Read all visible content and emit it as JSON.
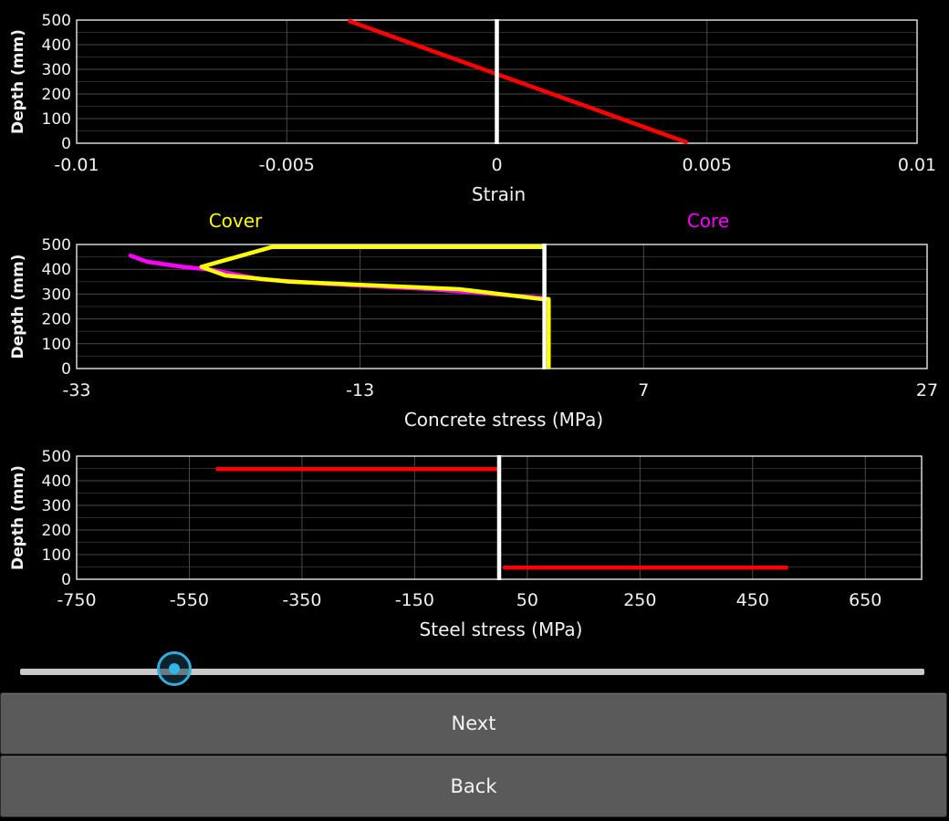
{
  "chart_data": [
    {
      "type": "line",
      "xlabel": "Strain",
      "ylabel": "Depth (mm)",
      "xlim": [
        -0.01,
        0.01
      ],
      "ylim": [
        0,
        500
      ],
      "x_ticks": [
        "-0.01",
        "-0.005",
        "0",
        "0.005",
        "0.01"
      ],
      "y_ticks": [
        "0",
        "100",
        "200",
        "300",
        "400",
        "500"
      ],
      "grid": true,
      "series": [
        {
          "color": "#ff0000",
          "points": [
            [
              -0.0035,
              495
            ],
            [
              0.0045,
              5
            ]
          ]
        }
      ],
      "reference_line": {
        "x": 0,
        "color": "#ffffff"
      }
    },
    {
      "type": "line",
      "xlabel": "Concrete stress (MPa)",
      "ylabel": "Depth (mm)",
      "xlim": [
        -33,
        27
      ],
      "ylim": [
        0,
        500
      ],
      "x_ticks": [
        "-33",
        "-13",
        "7",
        "27"
      ],
      "y_ticks": [
        "0",
        "100",
        "200",
        "300",
        "400",
        "500"
      ],
      "grid": true,
      "legend": [
        "Cover",
        "Core"
      ],
      "series": [
        {
          "name": "Core",
          "color": "#ff00ff",
          "points": [
            [
              -29.2,
              455
            ],
            [
              -28,
              430
            ],
            [
              -25.5,
              410
            ],
            [
              -23.5,
              398
            ],
            [
              -20,
              360
            ],
            [
              -15,
              340
            ],
            [
              -8,
              320
            ],
            [
              -0.2,
              285
            ]
          ]
        },
        {
          "name": "Cover",
          "color": "#ffff00",
          "points": [
            [
              -0.2,
              490
            ],
            [
              -19.2,
              490
            ],
            [
              -24.2,
              410
            ],
            [
              -22.5,
              375
            ],
            [
              -18,
              350
            ],
            [
              -12,
              335
            ],
            [
              -6,
              320
            ],
            [
              -0.2,
              280
            ],
            [
              0.3,
              280
            ],
            [
              0.3,
              5
            ]
          ]
        }
      ],
      "reference_line": {
        "x": 0,
        "color": "#ffffff"
      }
    },
    {
      "type": "line",
      "xlabel": "Steel stress (MPa)",
      "ylabel": "Depth (mm)",
      "xlim": [
        -750,
        750
      ],
      "ylim": [
        0,
        500
      ],
      "x_ticks": [
        "-750",
        "-550",
        "-350",
        "-150",
        "50",
        "250",
        "450",
        "650"
      ],
      "y_ticks": [
        "0",
        "100",
        "200",
        "300",
        "400",
        "500"
      ],
      "grid": true,
      "series": [
        {
          "color": "#ff0000",
          "points": [
            [
              -500,
              447
            ],
            [
              0,
              447
            ]
          ]
        },
        {
          "color": "#ff0000",
          "points": [
            [
              10,
              47
            ],
            [
              510,
              47
            ]
          ]
        }
      ],
      "reference_line": {
        "x": 0,
        "color": "#ffffff"
      }
    }
  ],
  "slider": {
    "position_fraction": 0.17
  },
  "buttons": {
    "next": "Next",
    "back": "Back"
  }
}
